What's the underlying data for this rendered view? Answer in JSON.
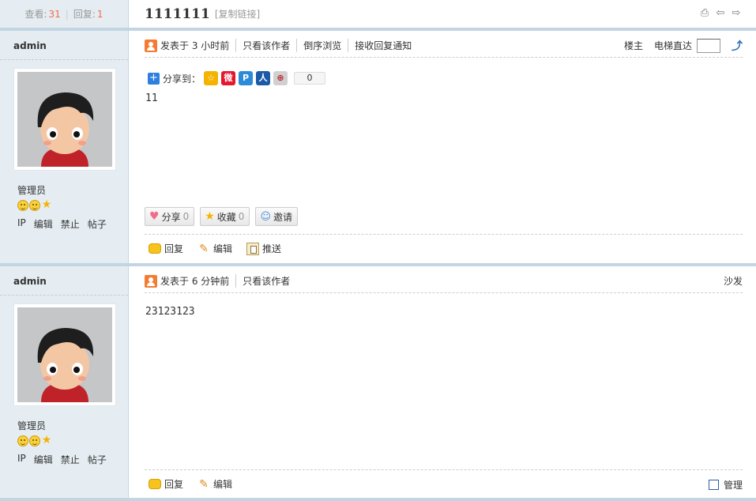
{
  "thread": {
    "views_label": "查看:",
    "views": "31",
    "replies_label": "回复:",
    "replies": "1",
    "title": "1111111",
    "copy_link": "[复制链接]"
  },
  "posts": [
    {
      "author": "admin",
      "role": "管理员",
      "admin_links": [
        "IP",
        "编辑",
        "禁止",
        "帖子"
      ],
      "posted": "发表于 3 小时前",
      "only_author": "只看该作者",
      "reverse": "倒序浏览",
      "notify": "接收回复通知",
      "floor": "楼主",
      "jump_label": "电梯直达",
      "share_label": "分享到：",
      "share_count": "0",
      "content": "11",
      "share_btn": "分享",
      "share_btn_count": "0",
      "fav_btn": "收藏",
      "fav_btn_count": "0",
      "invite_btn": "邀请",
      "reply": "回复",
      "edit": "编辑",
      "push": "推送"
    },
    {
      "author": "admin",
      "role": "管理员",
      "admin_links": [
        "IP",
        "编辑",
        "禁止",
        "帖子"
      ],
      "posted": "发表于 6 分钟前",
      "only_author": "只看该作者",
      "floor": "沙发",
      "content": "23123123",
      "reply": "回复",
      "edit": "编辑",
      "manage": "管理"
    }
  ],
  "icons": {
    "print": "print-icon",
    "prev": "prev-thread-icon",
    "next": "next-thread-icon"
  },
  "colors": {
    "sidebar_bg": "#e5edf2",
    "border": "#c2d5e3",
    "count": "#f26c4f"
  }
}
